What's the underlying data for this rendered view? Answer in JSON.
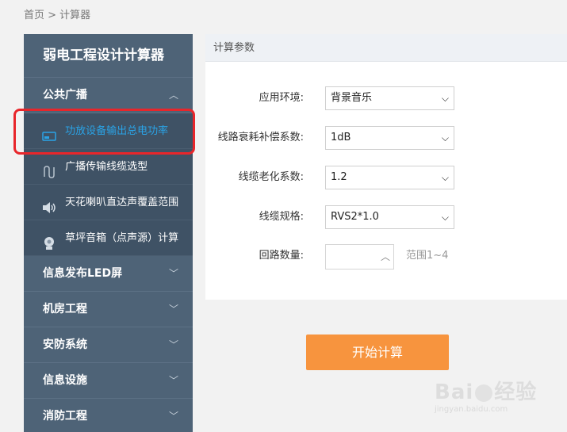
{
  "breadcrumb": "首页 > 计算器",
  "sidebar": {
    "title": "弱电工程设计计算器",
    "expanded_section": "公共广播",
    "expanded_chevron": "︿",
    "sub_items": [
      {
        "label": "功放设备输出总电功率",
        "icon": "amplifier-icon",
        "active": true
      },
      {
        "label": "广播传输线缆选型",
        "icon": "cable-icon",
        "active": false
      },
      {
        "label": "天花喇叭直达声覆盖范围",
        "icon": "speaker-icon",
        "active": false
      },
      {
        "label": "草坪音箱（点声源）计算",
        "icon": "lawn-speaker-icon",
        "active": false
      }
    ],
    "sections": [
      "信息发布LED屏",
      "机房工程",
      "安防系统",
      "信息设施",
      "消防工程"
    ],
    "collapsed_chevron": "﹀"
  },
  "panel": {
    "header": "计算参数",
    "fields": [
      {
        "label": "应用环境:",
        "value": "背景音乐"
      },
      {
        "label": "线路衰耗补偿系数:",
        "value": "1dB"
      },
      {
        "label": "线缆老化系数:",
        "value": "1.2"
      },
      {
        "label": "线缆规格:",
        "value": "RVS2*1.0"
      }
    ],
    "loop_count": {
      "label": "回路数量:",
      "value": "",
      "hint": "范围1~4"
    }
  },
  "start_button": "开始计算",
  "watermark": {
    "brand_left": "Bai",
    "brand_right": "经验",
    "url": "jingyan.baidu.com"
  },
  "colors": {
    "sidebar": "#4e6377",
    "active_item": "#2aa3e6",
    "button": "#f7943e",
    "highlight": "#e8262b"
  }
}
